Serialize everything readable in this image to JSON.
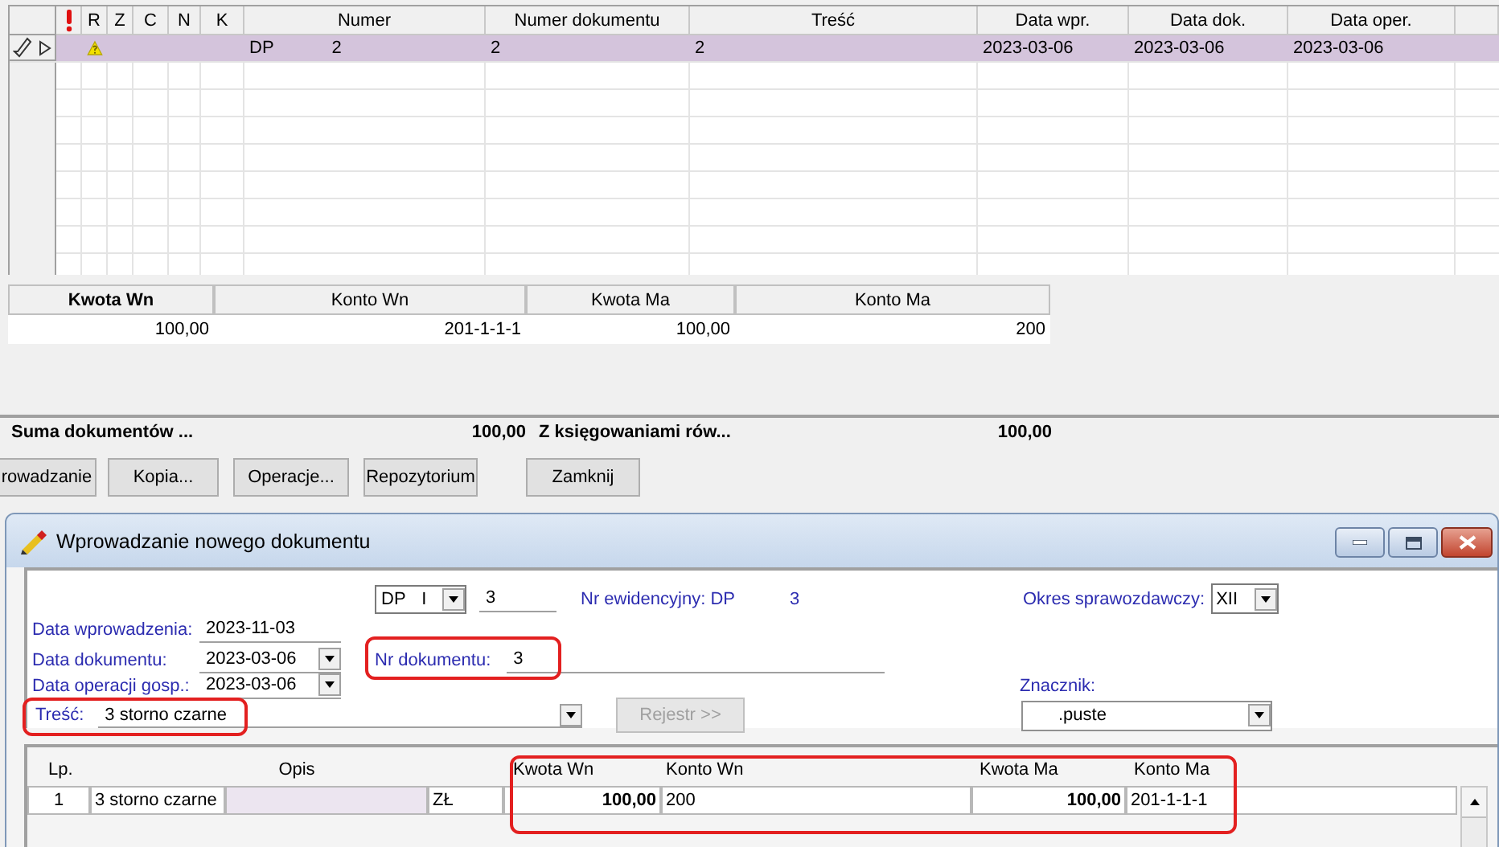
{
  "documents_table": {
    "columns": [
      "R",
      "Z",
      "C",
      "N",
      "K",
      "Numer",
      "Numer dokumentu",
      "Treść",
      "Data wpr.",
      "Data dok.",
      "Data oper."
    ],
    "rows": [
      {
        "selected": true,
        "warning": true,
        "numer_prefix": "DP",
        "numer": "2",
        "numer_dokumentu": "2",
        "tresc": "2",
        "data_wpr": "2023-03-06",
        "data_dok": "2023-03-06",
        "data_oper": "2023-03-06"
      }
    ]
  },
  "postings_table": {
    "columns": [
      {
        "label": "Kwota Wn",
        "sorted": true
      },
      {
        "label": "Konto Wn",
        "sorted": false
      },
      {
        "label": "Kwota Ma",
        "sorted": false
      },
      {
        "label": "Konto Ma",
        "sorted": false
      }
    ],
    "rows": [
      [
        "100,00",
        "201-1-1-1",
        "100,00",
        "200"
      ]
    ]
  },
  "summary": [
    {
      "label": "Suma dokumentów ...",
      "value": "100,00"
    },
    {
      "label": "Z księgowaniami rów...",
      "value": "100,00"
    }
  ],
  "buttons": [
    "rowadzanie",
    "Kopia...",
    "Operacje...",
    "Repozytorium",
    "Zamknij"
  ],
  "dialog": {
    "title": "Wprowadzanie nowego dokumentu",
    "document_type": {
      "code": "DP",
      "suffix": "I"
    },
    "number": "3",
    "nr_ewidencyjny": {
      "label": "Nr ewidencyjny: DP",
      "value": "3"
    },
    "okres": {
      "label": "Okres sprawozdawczy:",
      "value": "XII"
    },
    "dates": [
      {
        "label": "Data wprowadzenia:",
        "value": "2023-11-03",
        "dropdown": false
      },
      {
        "label": "Data dokumentu:",
        "value": "2023-03-06",
        "dropdown": true
      },
      {
        "label": "Data operacji gosp.:",
        "value": "2023-03-06",
        "dropdown": true
      }
    ],
    "nr_dokumentu": {
      "label": "Nr dokumentu:",
      "value": "3",
      "highlighted": true
    },
    "tresc": {
      "label": "Treść:",
      "value": "3 storno czarne",
      "highlighted": true
    },
    "rejestr_button": {
      "label": "Rejestr >>",
      "disabled": true
    },
    "znacznik": {
      "label": "Znacznik:",
      "value": ".puste"
    },
    "lines": {
      "columns": [
        "Lp.",
        "Opis",
        "Kwota Wn",
        "Konto Wn",
        "Kwota Ma",
        "Konto Ma"
      ],
      "amounts_highlighted": true,
      "rows": [
        {
          "lp": "1",
          "opis": "3 storno czarne",
          "currency": "ZŁ",
          "kwota_wn": "100,00",
          "konto_wn": "200",
          "kwota_ma": "100,00",
          "konto_ma": "201-1-1-1"
        }
      ]
    }
  }
}
